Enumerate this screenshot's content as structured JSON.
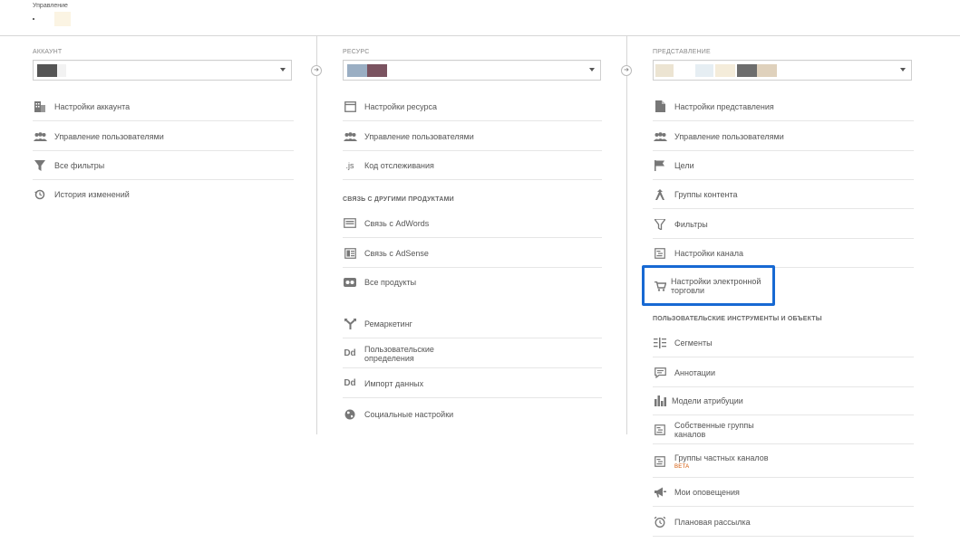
{
  "header": {
    "title": "Управление"
  },
  "account": {
    "label": "АККАУНТ",
    "items": [
      {
        "label": "Настройки аккаунта",
        "icon": "building-icon"
      },
      {
        "label": "Управление пользователями",
        "icon": "users-icon"
      },
      {
        "label": "Все фильтры",
        "icon": "filter-icon"
      },
      {
        "label": "История изменений",
        "icon": "history-icon"
      }
    ]
  },
  "property": {
    "label": "РЕСУРС",
    "items": [
      {
        "label": "Настройки ресурса",
        "icon": "window-icon"
      },
      {
        "label": "Управление пользователями",
        "icon": "users-icon"
      },
      {
        "label": "Код отслеживания",
        "icon": "js-icon",
        "glyph": ".js"
      }
    ],
    "section": "СВЯЗЬ С ДРУГИМИ ПРОДУКТАМИ",
    "linked": [
      {
        "label": "Связь с AdWords",
        "icon": "adwords-icon"
      },
      {
        "label": "Связь с AdSense",
        "icon": "adsense-icon"
      },
      {
        "label": "Все продукты",
        "icon": "products-icon"
      }
    ],
    "more": [
      {
        "label": "Ремаркетинг",
        "icon": "remarketing-icon"
      },
      {
        "label": "Пользовательские определения",
        "icon": "dd-icon",
        "glyph": "Dd"
      },
      {
        "label": "Импорт данных",
        "icon": "dd-icon",
        "glyph": "Dd"
      },
      {
        "label": "Социальные настройки",
        "icon": "globe-icon"
      }
    ]
  },
  "view": {
    "label": "ПРЕДСТАВЛЕНИЕ",
    "items": [
      {
        "label": "Настройки представления",
        "icon": "document-icon"
      },
      {
        "label": "Управление пользователями",
        "icon": "users-icon"
      },
      {
        "label": "Цели",
        "icon": "flag-icon"
      },
      {
        "label": "Группы контента",
        "icon": "content-group-icon"
      },
      {
        "label": "Фильтры",
        "icon": "filter-icon"
      },
      {
        "label": "Настройки канала",
        "icon": "channel-icon"
      },
      {
        "label": "Настройки электронной торговли",
        "icon": "cart-icon"
      }
    ],
    "section": "ПОЛЬЗОВАТЕЛЬСКИЕ ИНСТРУМЕНТЫ И ОБЪЕКТЫ",
    "tools": [
      {
        "label": "Сегменты",
        "icon": "segments-icon"
      },
      {
        "label": "Аннотации",
        "icon": "annotation-icon"
      },
      {
        "label": "Модели атрибуции",
        "icon": "bar-chart-icon"
      },
      {
        "label": "Собственные группы каналов",
        "icon": "channel-icon"
      },
      {
        "label": "Группы частных каналов",
        "icon": "channel-icon",
        "badge": "BETA"
      },
      {
        "label": "Мои оповещения",
        "icon": "megaphone-icon"
      },
      {
        "label": "Плановая рассылка",
        "icon": "clock-icon"
      }
    ]
  },
  "colors": {
    "highlight": "#1769d3",
    "beta": "#d35400"
  }
}
